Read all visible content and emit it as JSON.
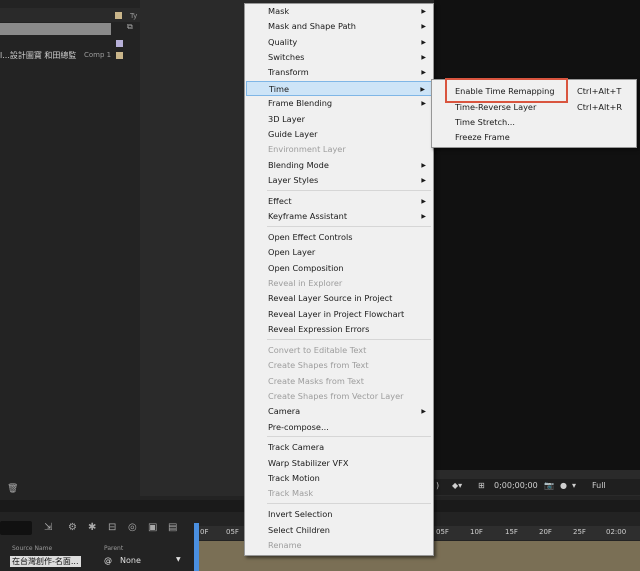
{
  "project": {
    "type_col": "Ty",
    "row_text": "l...設計圖寶 和田總監",
    "row_comp": "Comp 1"
  },
  "viewer_toolbar": {
    "timecode": "0;00;00;00",
    "resolution": "Full"
  },
  "timeline": {
    "col_source_name": "Source Name",
    "col_parent": "Parent",
    "layer_name": "在台灣創作-名面...",
    "parent_value": "None",
    "ruler_marks": [
      "0F",
      "05F",
      "05F",
      "10F",
      "15F",
      "20F",
      "25F",
      "02:00"
    ]
  },
  "context_menu": {
    "items": [
      {
        "label": "Mask",
        "submenu": true,
        "disabled": false
      },
      {
        "label": "Mask and Shape Path",
        "submenu": true,
        "disabled": false
      },
      {
        "label": "Quality",
        "submenu": true,
        "disabled": false
      },
      {
        "label": "Switches",
        "submenu": true,
        "disabled": false
      },
      {
        "label": "Transform",
        "submenu": true,
        "disabled": false
      },
      {
        "label": "Time",
        "submenu": true,
        "disabled": false
      },
      {
        "label": "Frame Blending",
        "submenu": true,
        "disabled": false
      },
      {
        "label": "3D Layer",
        "submenu": false,
        "disabled": false
      },
      {
        "label": "Guide Layer",
        "submenu": false,
        "disabled": false
      },
      {
        "label": "Environment Layer",
        "submenu": false,
        "disabled": true
      },
      {
        "label": "Blending Mode",
        "submenu": true,
        "disabled": false
      },
      {
        "label": "Layer Styles",
        "submenu": true,
        "disabled": false
      },
      {
        "label": "Effect",
        "submenu": true,
        "disabled": false
      },
      {
        "label": "Keyframe Assistant",
        "submenu": true,
        "disabled": false
      },
      {
        "label": "Open Effect Controls",
        "submenu": false,
        "disabled": false
      },
      {
        "label": "Open Layer",
        "submenu": false,
        "disabled": false
      },
      {
        "label": "Open Composition",
        "submenu": false,
        "disabled": false
      },
      {
        "label": "Reveal in Explorer",
        "submenu": false,
        "disabled": true
      },
      {
        "label": "Reveal Layer Source in Project",
        "submenu": false,
        "disabled": false
      },
      {
        "label": "Reveal Layer in Project Flowchart",
        "submenu": false,
        "disabled": false
      },
      {
        "label": "Reveal Expression Errors",
        "submenu": false,
        "disabled": false
      },
      {
        "label": "Convert to Editable Text",
        "submenu": false,
        "disabled": true
      },
      {
        "label": "Create Shapes from Text",
        "submenu": false,
        "disabled": true
      },
      {
        "label": "Create Masks from Text",
        "submenu": false,
        "disabled": true
      },
      {
        "label": "Create Shapes from Vector Layer",
        "submenu": false,
        "disabled": true
      },
      {
        "label": "Camera",
        "submenu": true,
        "disabled": false
      },
      {
        "label": "Pre-compose...",
        "submenu": false,
        "disabled": false
      },
      {
        "label": "Track Camera",
        "submenu": false,
        "disabled": false
      },
      {
        "label": "Warp Stabilizer VFX",
        "submenu": false,
        "disabled": false
      },
      {
        "label": "Track Motion",
        "submenu": false,
        "disabled": false
      },
      {
        "label": "Track Mask",
        "submenu": false,
        "disabled": true
      },
      {
        "label": "Invert Selection",
        "submenu": false,
        "disabled": false
      },
      {
        "label": "Select Children",
        "submenu": false,
        "disabled": false
      },
      {
        "label": "Rename",
        "submenu": false,
        "disabled": true
      }
    ]
  },
  "time_submenu": {
    "items": [
      {
        "label": "Enable Time Remapping",
        "shortcut": "Ctrl+Alt+T"
      },
      {
        "label": "Time-Reverse Layer",
        "shortcut": "Ctrl+Alt+R"
      },
      {
        "label": "Time Stretch...",
        "shortcut": ""
      },
      {
        "label": "Freeze Frame",
        "shortcut": ""
      }
    ]
  }
}
